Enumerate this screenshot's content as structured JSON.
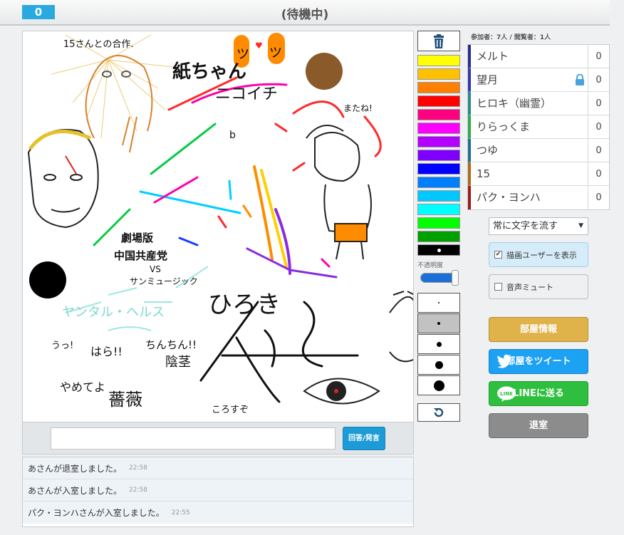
{
  "header": {
    "score": "0",
    "status": "(待機中)"
  },
  "canvas": {
    "texts": {
      "collab": "15さんとの合作.",
      "kami": "紙ちゃん",
      "nikoichi": "ニコイチ",
      "mataneh": "またね!",
      "wakan": "劇場版",
      "party": "中国共産党",
      "vs": "VS",
      "music": "サンミュージック",
      "hiro": "ひろき",
      "kokoro": "ころすぞ",
      "hara": "はら!!",
      "chin": "ちんちん!!",
      "inkei": "陰茎",
      "bara": "薔薇",
      "uu": "うっ!",
      "yameteyo": "やめてよ",
      "sleepy": "ヤンタル・ヘルス",
      "ans": "ツ",
      "b": "b"
    },
    "colors": [
      "#000000",
      "#ff8c00",
      "#e8a21a",
      "#ffd000",
      "#ff2a2a",
      "#ff00aa",
      "#8a2be2",
      "#00cfff",
      "#00cc44",
      "#1a3cff",
      "#8b5a2b",
      "#9be8e0"
    ]
  },
  "answer": {
    "placeholder": "",
    "button_label": "回答/発言"
  },
  "chat": [
    {
      "text": "あさんが退室しました。",
      "time": "22:58"
    },
    {
      "text": "あさんが入室しました。",
      "time": "22:58"
    },
    {
      "text": "パク・ヨンハさんが入室しました。",
      "time": "22:55"
    }
  ],
  "tools": {
    "trash_icon": "trash-icon",
    "palette": [
      "#ffff00",
      "#ffc000",
      "#ff8000",
      "#ff0000",
      "#ff0080",
      "#ff00ff",
      "#b400ff",
      "#8000ff",
      "#0000ff",
      "#0080ff",
      "#00c8ff",
      "#00ffff",
      "#00ff00",
      "#00a000",
      "#000000"
    ],
    "selected_color_index": 14,
    "opacity_label": "不透明度",
    "opacity_level": 1.0,
    "brush_sizes": [
      2,
      4,
      7,
      11,
      15
    ],
    "selected_size_index": 1,
    "undo_icon": "undo-icon"
  },
  "sidebar": {
    "participant_count": "参加者：7人 / 閲覧者：1人",
    "players": [
      {
        "name": "メルト",
        "score": "0",
        "color": "#2b2b8c",
        "locked": false
      },
      {
        "name": "望月",
        "score": "0",
        "color": "#3535b0",
        "locked": true
      },
      {
        "name": "ヒロキ（幽霊）",
        "score": "0",
        "color": "#2a8a8a",
        "locked": false
      },
      {
        "name": "りらっくま",
        "score": "0",
        "color": "#2faa50",
        "locked": false
      },
      {
        "name": "つゆ",
        "score": "0",
        "color": "#1f6f8f",
        "locked": false
      },
      {
        "name": "15",
        "score": "0",
        "color": "#b06a1a",
        "locked": false
      },
      {
        "name": "パク・ヨンハ",
        "score": "0",
        "color": "#a01a1a",
        "locked": false
      }
    ],
    "mode_select": "常に文字を流す",
    "show_drawer_label": "描画ユーザーを表示",
    "show_drawer_checked": true,
    "mute_label": "音声ミュート",
    "mute_checked": false,
    "room_info_label": "部屋情報",
    "tweet_label": "部屋をツイート",
    "line_label": "LINEに送る",
    "leave_label": "退室",
    "colors": {
      "room_info": "#e0b24a",
      "tweet": "#1da1f2",
      "line": "#2fbf3f",
      "leave": "#8c8c8c"
    }
  }
}
